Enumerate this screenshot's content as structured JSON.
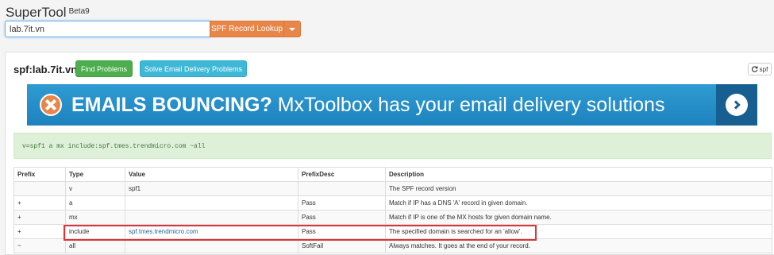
{
  "header": {
    "brand": "SuperTool",
    "beta": "Beta9"
  },
  "search": {
    "value": "lab.7it.vn",
    "button_label": "SPF Record Lookup"
  },
  "result": {
    "title": "spf:lab.7it.vn",
    "find_problems_label": "Find Problems",
    "solve_label": "Solve Email Delivery Problems",
    "refresh_label": "spf"
  },
  "banner": {
    "bold_text": "EMAILS BOUNCING?",
    "text": "MxToolbox has your email delivery solutions"
  },
  "spf_record": "v=spf1 a mx include:spf.tmes.trendmicro.com ~all",
  "table": {
    "headers": [
      "Prefix",
      "Type",
      "Value",
      "PrefixDesc",
      "Description"
    ],
    "rows": [
      [
        "",
        "v",
        "spf1",
        "",
        "The SPF record version"
      ],
      [
        "+",
        "a",
        "",
        "Pass",
        "Match if IP has a DNS 'A' record in given domain."
      ],
      [
        "+",
        "mx",
        "",
        "Pass",
        "Match if IP is one of the MX hosts for given domain name."
      ],
      [
        "+",
        "include",
        "spf.tmes.trendmicro.com",
        "Pass",
        "The specified domain is searched for an 'allow'."
      ],
      [
        "~",
        "all",
        "",
        "SoftFail",
        "Always matches. It goes at the end of your record."
      ]
    ]
  },
  "colors": {
    "accent": "#e8864a",
    "green": "#4cae4c",
    "info": "#3fb8d8",
    "highlight": "#d9353a"
  }
}
